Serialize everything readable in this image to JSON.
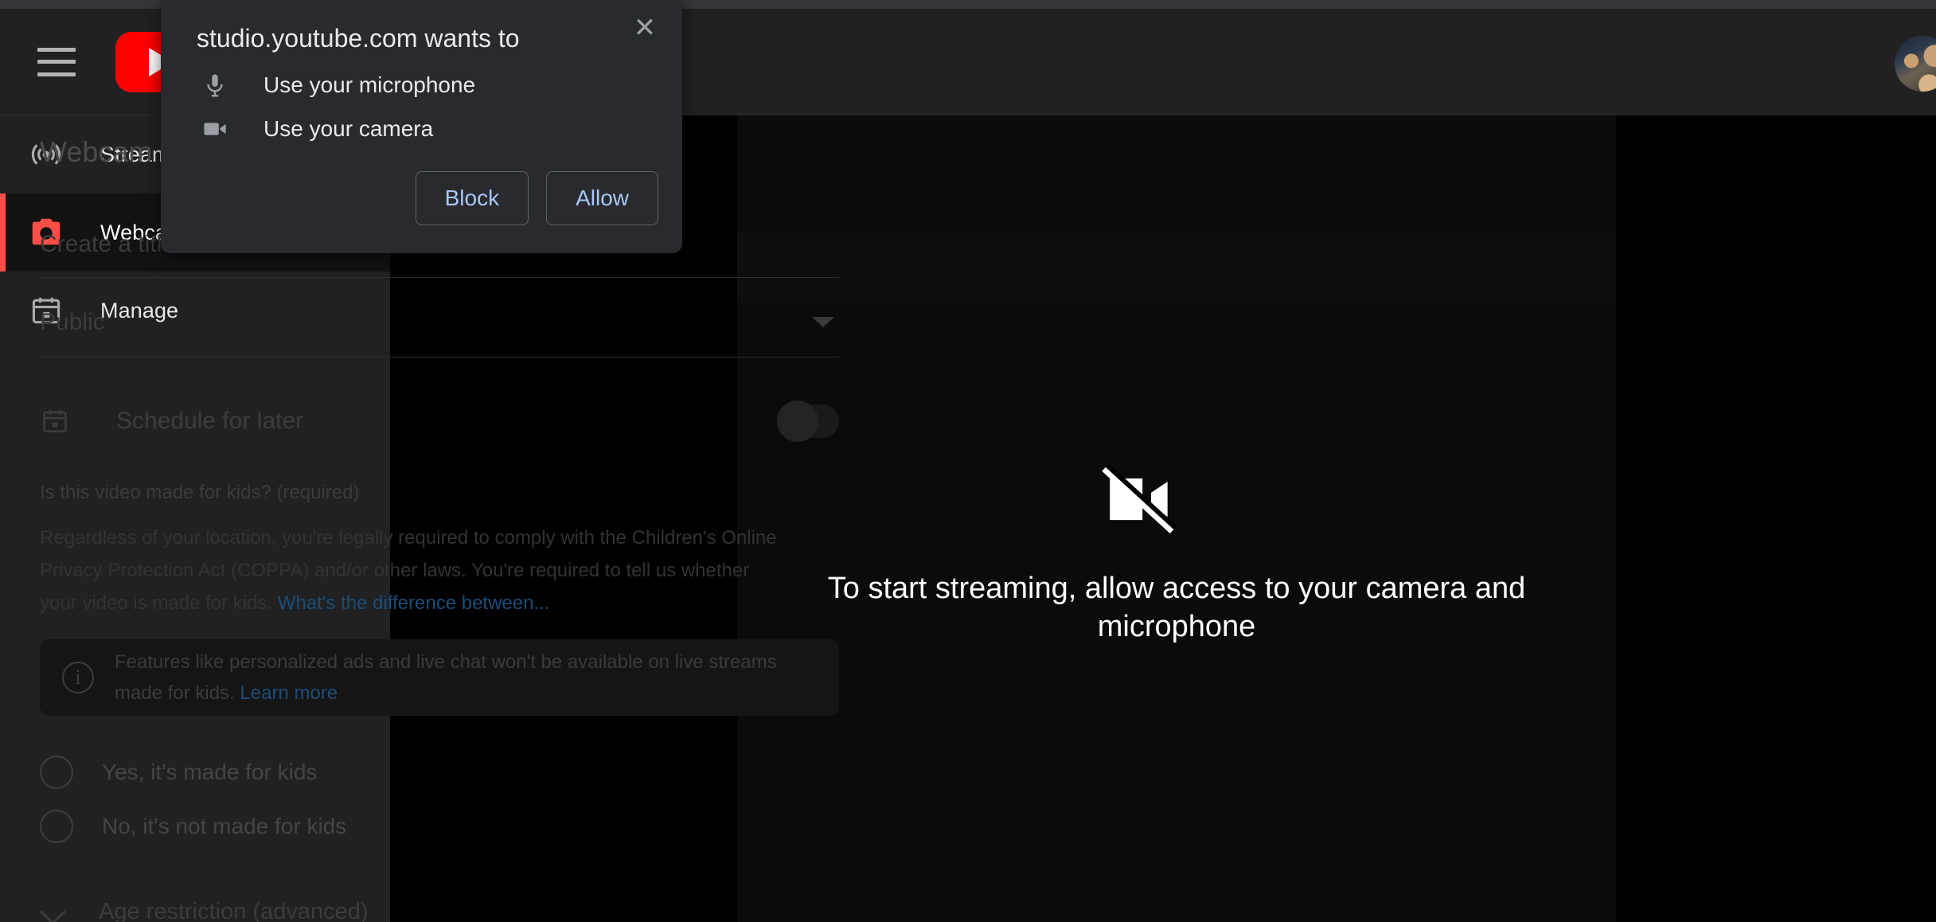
{
  "header": {
    "menu_icon": "hamburger-menu-icon",
    "logo": "youtube-logo-icon",
    "avatar": "user-avatar"
  },
  "sidebar": {
    "items": [
      {
        "id": "stream",
        "label": "Stream",
        "icon": "broadcast-icon",
        "active": false
      },
      {
        "id": "webcam",
        "label": "Webcam",
        "icon": "camera-icon",
        "active": true
      },
      {
        "id": "manage",
        "label": "Manage",
        "icon": "calendar-icon",
        "active": false
      }
    ]
  },
  "panel": {
    "title": "Webcam stream info",
    "title_field": {
      "placeholder": "Create a title",
      "value": ""
    },
    "visibility": {
      "value": "Public",
      "caret_icon": "chevron-down-icon"
    },
    "schedule": {
      "icon": "calendar-icon",
      "label": "Schedule for later",
      "enabled": false
    },
    "kids": {
      "question": "Is this video made for kids? (required)",
      "paragraph_1": "Regardless of your location, you're legally required to comply with the Children's Online",
      "paragraph_2": "Privacy Protection Act (COPPA) and/or other laws. You're required to tell us whether",
      "paragraph_3": "your video is made for kids.",
      "paragraph_link": "What's the difference between...",
      "info_icon": "info-icon",
      "info_text": "Features like personalized ads and live chat won't be available on live streams made for kids.",
      "info_link": "Learn more",
      "option_yes": "Yes, it's made for kids",
      "option_no": "No, it's not made for kids"
    },
    "age_restriction": {
      "label": "Age restriction (advanced)",
      "icon": "chevron-down-icon"
    }
  },
  "overlay": {
    "icon": "camera-off-icon",
    "message_line_1": "To start streaming, allow access to your camera and",
    "message_line_2": "microphone"
  },
  "permission_dialog": {
    "title": "studio.youtube.com wants to",
    "close_icon": "close-icon",
    "items": [
      {
        "icon": "microphone-icon",
        "label": "Use your microphone"
      },
      {
        "icon": "video-camera-icon",
        "label": "Use your camera"
      }
    ],
    "block_label": "Block",
    "allow_label": "Allow"
  },
  "colors": {
    "accent_red": "#ff4e45",
    "youtube_red": "#ff0000",
    "dialog_bg": "#292a2d",
    "link_blue": "#a8c7fa"
  }
}
